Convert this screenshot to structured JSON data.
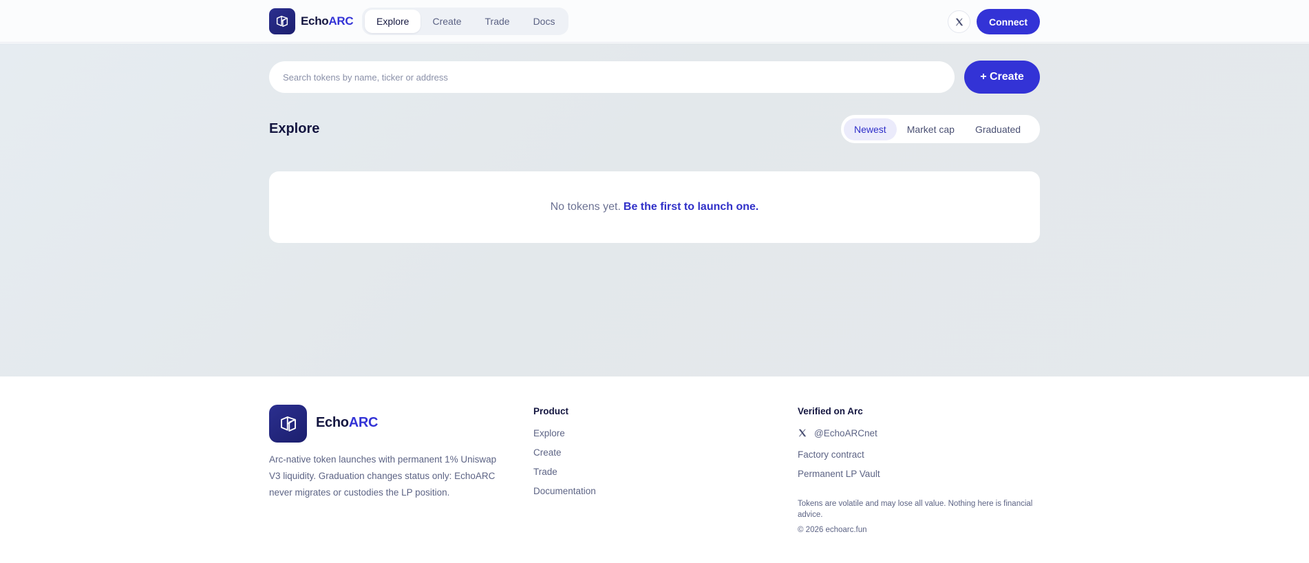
{
  "header": {
    "brand_prefix": "Echo",
    "brand_accent": "ARC",
    "nav": [
      {
        "label": "Explore",
        "active": true
      },
      {
        "label": "Create",
        "active": false
      },
      {
        "label": "Trade",
        "active": false
      },
      {
        "label": "Docs",
        "active": false
      }
    ],
    "connect_label": "Connect"
  },
  "search": {
    "placeholder": "Search tokens by name, ticker or address",
    "create_label": "+ Create"
  },
  "explore": {
    "title": "Explore",
    "sort_options": [
      {
        "label": "Newest",
        "active": true
      },
      {
        "label": "Market cap",
        "active": false
      },
      {
        "label": "Graduated",
        "active": false
      }
    ],
    "empty_text": "No tokens yet.",
    "empty_link": "Be the first to launch one."
  },
  "footer": {
    "brand_prefix": "Echo",
    "brand_accent": "ARC",
    "description": "Arc-native token launches with permanent 1% Uniswap V3 liquidity. Graduation changes status only: EchoARC never migrates or custodies the LP position.",
    "product_heading": "Product",
    "product_links": [
      "Explore",
      "Create",
      "Trade",
      "Documentation"
    ],
    "verified_heading": "Verified on Arc",
    "x_handle": "@EchoARCnet",
    "factory_link": "Factory contract",
    "vault_link": "Permanent LP Vault",
    "disclaimer": "Tokens are volatile and may lose all value. Nothing here is financial advice.",
    "copyright": "© 2026 echoarc.fun"
  },
  "colors": {
    "accent": "#3333d6",
    "logo_bg": "#1f2275",
    "text_dark": "#141640",
    "text_muted": "#5d6485"
  },
  "icons": [
    "echoarc-logo-icon",
    "x-social-icon"
  ]
}
